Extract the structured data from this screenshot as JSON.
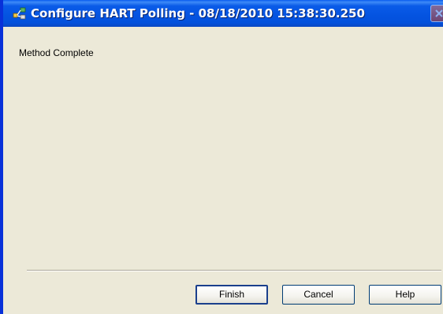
{
  "window": {
    "title": "Configure HART Polling - 08/18/2010 15:38:30.250",
    "app_icon": "hart-polling-icon",
    "close_icon": "close-icon"
  },
  "content": {
    "status_text": "Method Complete"
  },
  "buttons": {
    "finish_label": "Finish",
    "cancel_label": "Cancel",
    "help_label": "Help"
  },
  "colors": {
    "titlebar": "#0453e0",
    "dialog_background": "#ece9d8",
    "window_border": "#0831d9"
  }
}
